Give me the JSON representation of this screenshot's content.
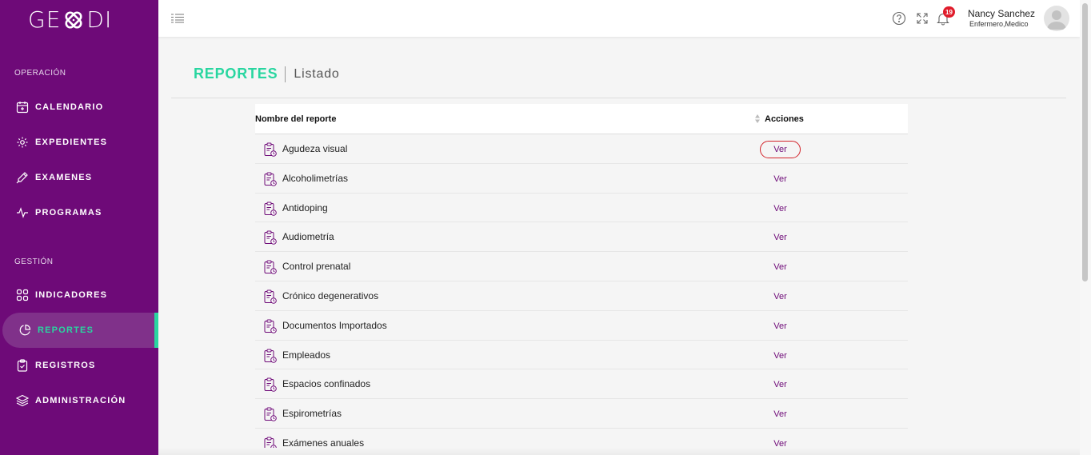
{
  "brand": {
    "logo_left": "GE",
    "logo_right": "DI"
  },
  "sidebar": {
    "section_operacion": "OPERACIÓN",
    "section_gestion": "GESTIÓN",
    "items": [
      {
        "label": "CALENDARIO",
        "icon": "calendar-icon"
      },
      {
        "label": "EXPEDIENTES",
        "icon": "gear-icon"
      },
      {
        "label": "EXAMENES",
        "icon": "pen-icon"
      },
      {
        "label": "PROGRAMAS",
        "icon": "pulse-icon"
      },
      {
        "label": "INDICADORES",
        "icon": "grid-icon"
      },
      {
        "label": "REPORTES",
        "icon": "pie-chart-icon"
      },
      {
        "label": "REGISTROS",
        "icon": "clipboard-icon"
      },
      {
        "label": "ADMINISTRACIÓN",
        "icon": "layers-icon"
      }
    ]
  },
  "topbar": {
    "notifications_count": "19",
    "user_name": "Nancy Sanchez",
    "user_role": "Enfermero,Medico"
  },
  "page": {
    "title": "REPORTES",
    "subtitle": "Listado"
  },
  "table": {
    "col_name": "Nombre del reporte",
    "col_actions": "Acciones",
    "action_label": "Ver",
    "rows": [
      "Agudeza visual",
      "Alcoholimetrías",
      "Antidoping",
      "Audiometría",
      "Control prenatal",
      "Crónico degenerativos",
      "Documentos Importados",
      "Empleados",
      "Espacios confinados",
      "Espirometrías",
      "Exámenes anuales"
    ]
  },
  "colors": {
    "primary": "#6e0a78",
    "accent": "#29d6a0",
    "badge": "#e01c2b"
  }
}
